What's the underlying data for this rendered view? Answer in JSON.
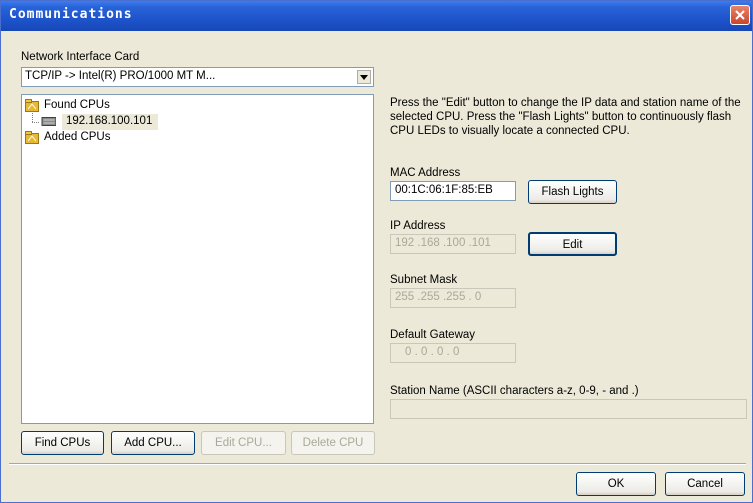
{
  "window": {
    "title": "Communications"
  },
  "nic": {
    "label": "Network Interface Card",
    "value": "TCP/IP -> Intel(R) PRO/1000 MT M..."
  },
  "tree": {
    "found_label": "Found CPUs",
    "found_child": "192.168.100.101",
    "added_label": "Added CPUs"
  },
  "buttons": {
    "find": "Find CPUs",
    "add": "Add CPU...",
    "edit_cpu": "Edit CPU...",
    "delete_cpu": "Delete CPU",
    "flash": "Flash Lights",
    "edit": "Edit",
    "ok": "OK",
    "cancel": "Cancel"
  },
  "info_text": "Press the \"Edit\" button to change the IP data and station name of the selected CPU. Press the \"Flash Lights\" button to continuously flash CPU LEDs to visually locate a connected CPU.",
  "mac": {
    "label": "MAC Address",
    "value": "00:1C:06:1F:85:EB"
  },
  "ip": {
    "label": "IP Address",
    "value": "192 .168 .100 .101"
  },
  "subnet": {
    "label": "Subnet Mask",
    "value": "255 .255 .255 .  0"
  },
  "gateway": {
    "label": "Default Gateway",
    "value": "0  .  0  .  0  .  0"
  },
  "station": {
    "label": "Station Name (ASCII characters a-z, 0-9, - and .)",
    "value": ""
  },
  "colors": {
    "titlebar": "#2a63d8",
    "dialog_bg": "#ece9d8",
    "folder": "#e8b830"
  }
}
